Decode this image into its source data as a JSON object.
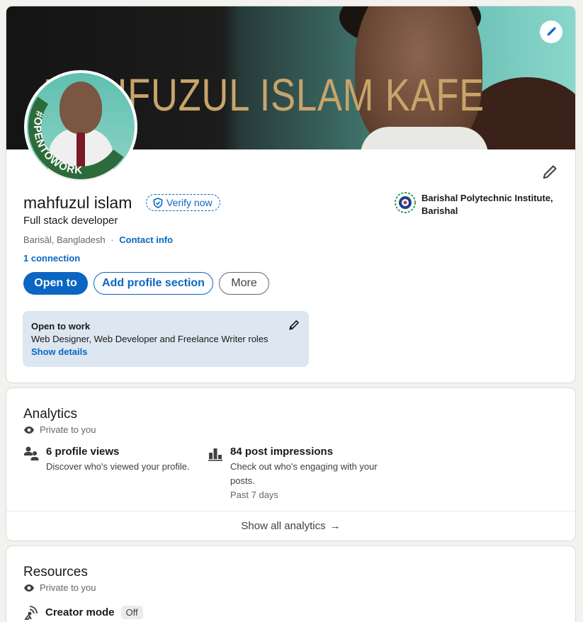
{
  "banner": {
    "text": "MAHFUZUL ISLAM KAFE"
  },
  "avatar": {
    "badge_text": "#OPENTOWORK"
  },
  "profile": {
    "name": "mahfuzul islam",
    "verify_label": "Verify now",
    "headline": "Full stack developer",
    "location": "Barisāl, Bangladesh",
    "location_separator": "·",
    "contact_label": "Contact info",
    "connections": "1 connection",
    "school": "Barishal Polytechnic Institute, Barishal"
  },
  "actions": {
    "open_to": "Open to",
    "add_section": "Add profile section",
    "more": "More"
  },
  "open_to_work": {
    "title": "Open to work",
    "roles": "Web Designer, Web Developer and Freelance Writer roles",
    "link": "Show details"
  },
  "analytics": {
    "title": "Analytics",
    "privacy": "Private to you",
    "profile_views": {
      "title": "6 profile views",
      "description": "Discover who's viewed your profile."
    },
    "post_impressions": {
      "title": "84 post impressions",
      "description": "Check out who's engaging with your posts.",
      "period": "Past 7 days"
    },
    "footer": "Show all analytics",
    "footer_arrow": "→"
  },
  "resources": {
    "title": "Resources",
    "privacy": "Private to you",
    "creator_mode": "Creator mode",
    "creator_status": "Off"
  },
  "colors": {
    "accent": "#0a66c2",
    "open_to_work_green": "#2e7d32",
    "highlight_bg": "#dde7f1"
  }
}
